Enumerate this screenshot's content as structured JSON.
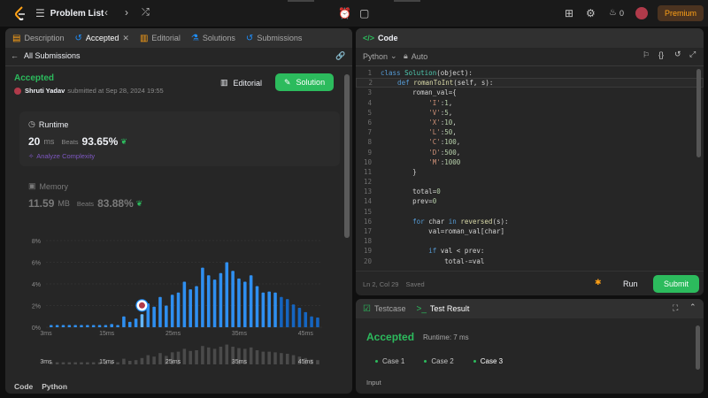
{
  "topbar": {
    "problem_list_label": "Problem List",
    "streak_count": "0",
    "premium_label": "Premium"
  },
  "left_panel": {
    "tabs": [
      {
        "label": "Description"
      },
      {
        "label": "Accepted"
      },
      {
        "label": "Editorial"
      },
      {
        "label": "Solutions"
      },
      {
        "label": "Submissions"
      }
    ],
    "back_label": "All Submissions",
    "status": "Accepted",
    "username": "Shruti Yadav",
    "submitted_text": "submitted at Sep 28, 2024 19:55",
    "editorial_label": "Editorial",
    "solution_label": "Solution",
    "runtime": {
      "title": "Runtime",
      "value": "20",
      "unit": "ms",
      "beats_label": "Beats",
      "beats_pct": "93.65%",
      "analyze_label": "Analyze Complexity"
    },
    "memory": {
      "title": "Memory",
      "value": "11.59",
      "unit": "MB",
      "beats_label": "Beats",
      "beats_pct": "83.88%"
    },
    "footer_code_label": "Code",
    "footer_lang_label": "Python"
  },
  "chart_data": {
    "type": "bar",
    "ylim": [
      0,
      8
    ],
    "y_ticks": [
      "8%",
      "6%",
      "4%",
      "2%",
      "0%"
    ],
    "x_ticks": [
      "3ms",
      "15ms",
      "25ms",
      "35ms",
      "45ms"
    ],
    "values": [
      0.2,
      0.2,
      0.2,
      0.2,
      0.2,
      0.2,
      0.2,
      0.2,
      0.2,
      0.2,
      0.3,
      0.2,
      1.0,
      0.5,
      0.8,
      1.2,
      2.2,
      1.9,
      2.8,
      2.0,
      3.0,
      3.2,
      4.2,
      3.5,
      3.8,
      5.5,
      4.8,
      4.4,
      5.0,
      6.0,
      5.2,
      4.5,
      4.2,
      4.8,
      3.8,
      3.2,
      3.3,
      3.2,
      2.8,
      2.6,
      2.1,
      1.8,
      1.4,
      1.0,
      0.9
    ],
    "highlight_index": 15,
    "secondary_values": [
      0.3,
      0.3,
      0.3,
      0.3,
      0.3,
      0.3,
      0.3,
      0.3,
      0.3,
      0.3,
      0.4,
      0.3,
      0.8,
      0.5,
      0.6,
      0.9,
      1.3,
      1.1,
      1.6,
      1.2,
      1.7,
      1.8,
      2.2,
      1.9,
      2.0,
      2.6,
      2.4,
      2.2,
      2.5,
      2.8,
      2.5,
      2.3,
      2.2,
      2.4,
      2.0,
      1.8,
      1.8,
      1.7,
      1.6,
      1.5,
      1.3,
      1.1,
      0.9,
      0.7,
      0.6
    ],
    "secondary_x_ticks": [
      "3ms",
      "15ms",
      "25ms",
      "35ms",
      "45ms"
    ]
  },
  "right_panel": {
    "code_tab_label": "Code",
    "language": "Python",
    "auto_label": "Auto",
    "code_lines": [
      [
        {
          "t": "class ",
          "c": "kw"
        },
        {
          "t": "Solution",
          "c": "bi"
        },
        {
          "t": "(object):",
          "c": "id"
        }
      ],
      [
        {
          "t": "    def ",
          "c": "kw"
        },
        {
          "t": "romanToInt",
          "c": "fn"
        },
        {
          "t": "(self, s):",
          "c": "id"
        }
      ],
      [
        {
          "t": "        roman_val={",
          "c": "id"
        }
      ],
      [
        {
          "t": "            ",
          "c": "id"
        },
        {
          "t": "'I'",
          "c": "str"
        },
        {
          "t": ":",
          "c": "id"
        },
        {
          "t": "1",
          "c": "num"
        },
        {
          "t": ",",
          "c": "id"
        }
      ],
      [
        {
          "t": "            ",
          "c": "id"
        },
        {
          "t": "'V'",
          "c": "str"
        },
        {
          "t": ":",
          "c": "id"
        },
        {
          "t": "5",
          "c": "num"
        },
        {
          "t": ",",
          "c": "id"
        }
      ],
      [
        {
          "t": "            ",
          "c": "id"
        },
        {
          "t": "'X'",
          "c": "str"
        },
        {
          "t": ":",
          "c": "id"
        },
        {
          "t": "10",
          "c": "num"
        },
        {
          "t": ",",
          "c": "id"
        }
      ],
      [
        {
          "t": "            ",
          "c": "id"
        },
        {
          "t": "'L'",
          "c": "str"
        },
        {
          "t": ":",
          "c": "id"
        },
        {
          "t": "50",
          "c": "num"
        },
        {
          "t": ",",
          "c": "id"
        }
      ],
      [
        {
          "t": "            ",
          "c": "id"
        },
        {
          "t": "'C'",
          "c": "str"
        },
        {
          "t": ":",
          "c": "id"
        },
        {
          "t": "100",
          "c": "num"
        },
        {
          "t": ",",
          "c": "id"
        }
      ],
      [
        {
          "t": "            ",
          "c": "id"
        },
        {
          "t": "'D'",
          "c": "str"
        },
        {
          "t": ":",
          "c": "id"
        },
        {
          "t": "500",
          "c": "num"
        },
        {
          "t": ",",
          "c": "id"
        }
      ],
      [
        {
          "t": "            ",
          "c": "id"
        },
        {
          "t": "'M'",
          "c": "str"
        },
        {
          "t": ":",
          "c": "id"
        },
        {
          "t": "1000",
          "c": "num"
        }
      ],
      [
        {
          "t": "        }",
          "c": "id"
        }
      ],
      [
        {
          "t": "",
          "c": "id"
        }
      ],
      [
        {
          "t": "        total=",
          "c": "id"
        },
        {
          "t": "0",
          "c": "num"
        }
      ],
      [
        {
          "t": "        prev=",
          "c": "id"
        },
        {
          "t": "0",
          "c": "num"
        }
      ],
      [
        {
          "t": "",
          "c": "id"
        }
      ],
      [
        {
          "t": "        ",
          "c": "id"
        },
        {
          "t": "for ",
          "c": "kw"
        },
        {
          "t": "char ",
          "c": "id"
        },
        {
          "t": "in ",
          "c": "kw"
        },
        {
          "t": "reversed",
          "c": "fn"
        },
        {
          "t": "(s):",
          "c": "id"
        }
      ],
      [
        {
          "t": "            val=roman_val[char]",
          "c": "id"
        }
      ],
      [
        {
          "t": "",
          "c": "id"
        }
      ],
      [
        {
          "t": "            ",
          "c": "id"
        },
        {
          "t": "if ",
          "c": "kw"
        },
        {
          "t": "val < prev:",
          "c": "id"
        }
      ],
      [
        {
          "t": "                total-=val",
          "c": "id"
        }
      ]
    ],
    "cursor_pos": "Ln 2, Col 29",
    "saved_label": "Saved",
    "run_label": "Run",
    "submit_label": "Submit"
  },
  "bottom_panel": {
    "testcase_label": "Testcase",
    "test_result_label": "Test Result",
    "status": "Accepted",
    "runtime_text": "Runtime: 7 ms",
    "cases": [
      {
        "label": "Case 1"
      },
      {
        "label": "Case 2"
      },
      {
        "label": "Case 3"
      }
    ],
    "input_label": "Input"
  },
  "colors": {
    "accent_green": "#2cbb5d",
    "accent_blue": "#1e90ff",
    "premium": "#ffa116"
  }
}
